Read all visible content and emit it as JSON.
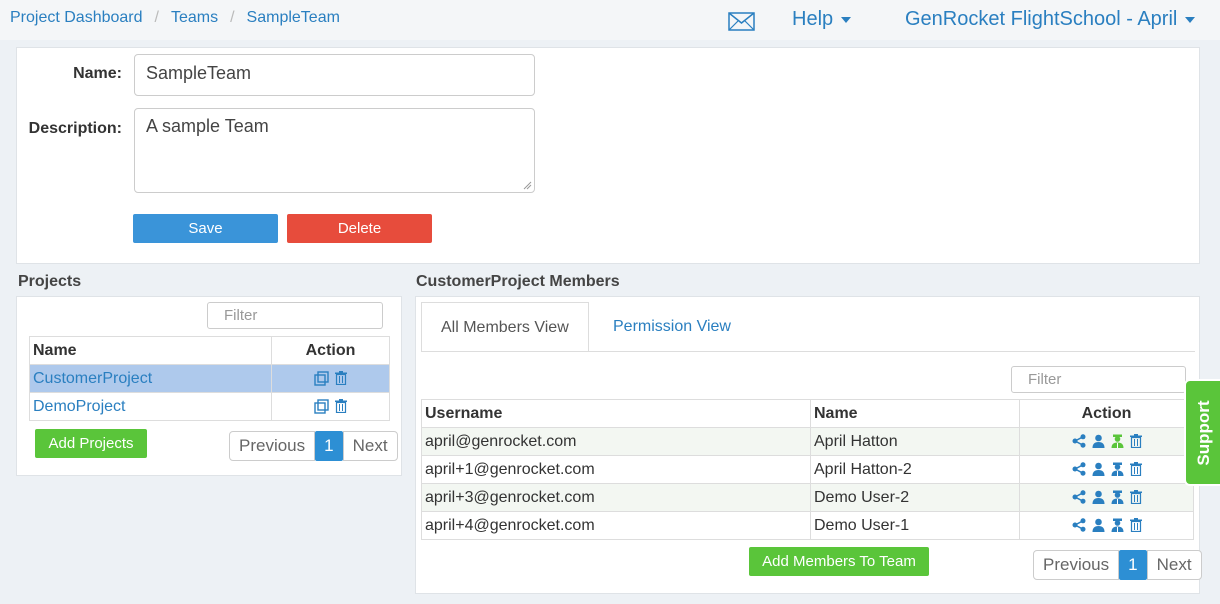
{
  "breadcrumb": {
    "items": [
      "Project Dashboard",
      "Teams",
      "SampleTeam"
    ],
    "sep": "/"
  },
  "header": {
    "help": "Help",
    "org": "GenRocket FlightSchool - April"
  },
  "form": {
    "name_label": "Name:",
    "name_value": "SampleTeam",
    "desc_label": "Description:",
    "desc_value": "A sample Team",
    "save": "Save",
    "delete": "Delete"
  },
  "projects": {
    "title": "Projects",
    "filter_placeholder": "Filter",
    "columns": [
      "Name",
      "Action"
    ],
    "rows": [
      "CustomerProject",
      "DemoProject"
    ],
    "add_button": "Add Projects",
    "pager": {
      "prev": "Previous",
      "page": "1",
      "next": "Next"
    }
  },
  "members": {
    "title": "CustomerProject Members",
    "tabs": [
      "All Members View",
      "Permission View"
    ],
    "filter_placeholder": "Filter",
    "columns": [
      "Username",
      "Name",
      "Action"
    ],
    "rows": [
      {
        "username": "april@genrocket.com",
        "name": "April Hatton"
      },
      {
        "username": "april+1@genrocket.com",
        "name": "April Hatton-2"
      },
      {
        "username": "april+3@genrocket.com",
        "name": "Demo User-2"
      },
      {
        "username": "april+4@genrocket.com",
        "name": "Demo User-1"
      }
    ],
    "add_button": "Add Members To Team",
    "pager": {
      "prev": "Previous",
      "page": "1",
      "next": "Next"
    }
  },
  "support": "Support",
  "colors": {
    "accent": "#2a7fc0",
    "save": "#3a94d9",
    "delete": "#e74c3c",
    "green": "#5ac53a",
    "selected_row": "#aec9ec"
  }
}
